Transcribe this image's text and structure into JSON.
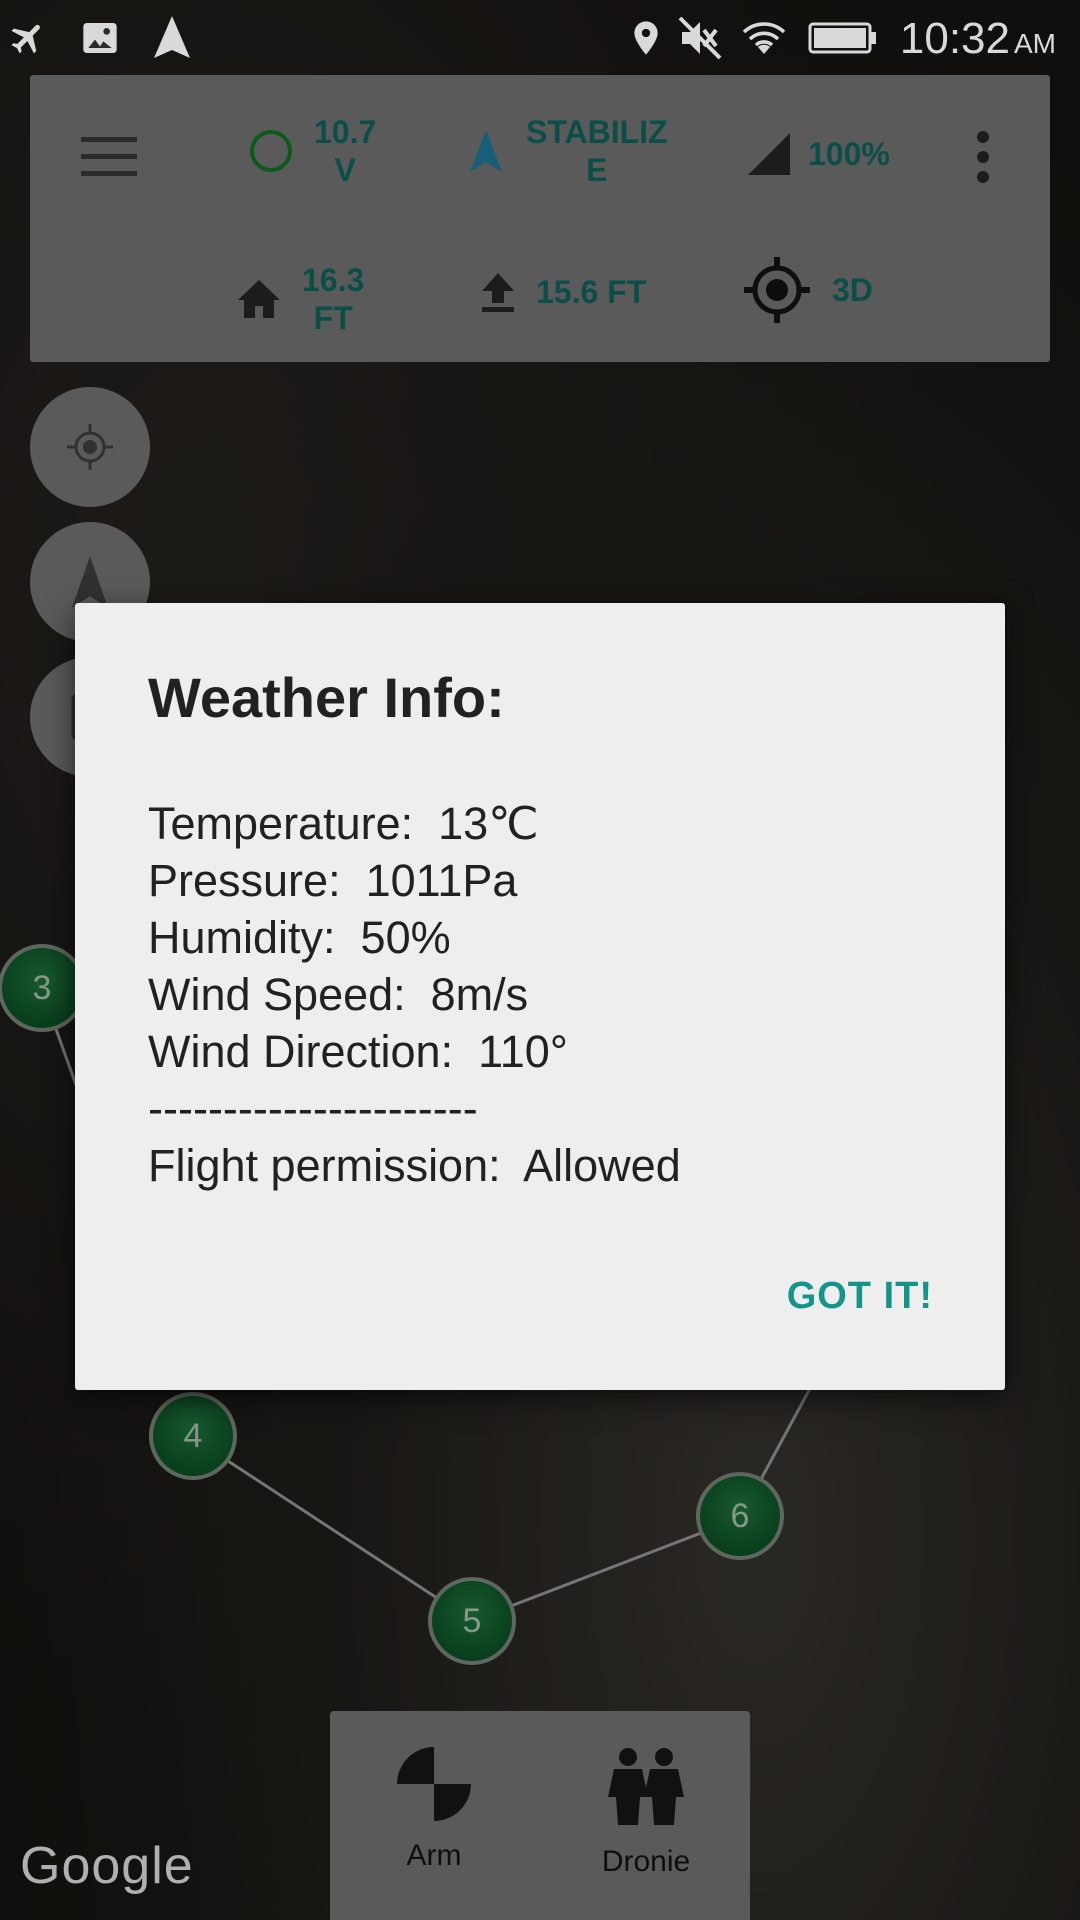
{
  "status_bar": {
    "icons": [
      "airplane-mode-icon",
      "image-icon",
      "navigation-icon",
      "location-icon",
      "mute-icon",
      "wifi-icon",
      "battery-icon"
    ],
    "time": "10:32",
    "ampm": "AM"
  },
  "telemetry": {
    "voltage": "10.7\nV",
    "mode": "STABILIZ\nE",
    "signal": "100%",
    "home_distance": "16.3\nFT",
    "altitude": "15.6 FT",
    "gps_fix": "3D"
  },
  "waypoints": [
    "3",
    "4",
    "5",
    "6"
  ],
  "dialog": {
    "title": "Weather Info:",
    "rows": [
      "Temperature:  13℃",
      "Pressure:  1011Pa",
      "Humidity:  50%",
      "Wind Speed:  8m/s",
      "Wind Direction:  110°",
      "----------------------",
      "Flight permission:  Allowed"
    ],
    "confirm_label": "GOT IT!"
  },
  "bottom_bar": {
    "arm_label": "Arm",
    "dronie_label": "Dronie"
  },
  "map_attribution": "Google",
  "colors": {
    "accent": "#15958a",
    "telemetry_text": "#0d5c55",
    "waypoint_green": "#0b4a22"
  }
}
